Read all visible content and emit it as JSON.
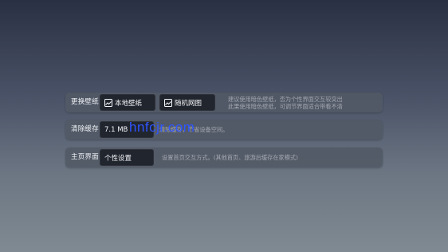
{
  "rows": [
    {
      "title": "更换壁纸",
      "buttons": [
        {
          "label": "本地壁纸",
          "icon": "image-icon"
        },
        {
          "label": "随机网图",
          "icon": "image-icon"
        }
      ],
      "description": [
        "建议使用暗色壁纸，否为个性界面交互较突出",
        "此果使用暗色壁纸，可调节界面适合带看不清"
      ]
    },
    {
      "title": "清除缓存",
      "buttons": [
        {
          "label": "7.1 MB",
          "icon": ""
        }
      ],
      "description": [
        "清除缓存，节省设备空间。"
      ]
    },
    {
      "title": "主页界面",
      "buttons": [
        {
          "label": "个性设置",
          "icon": ""
        }
      ],
      "description": [
        "设置首页交互方式。(其他首页、旅游后缓存在家模式)"
      ]
    }
  ],
  "watermark": "hnfcjr.com"
}
